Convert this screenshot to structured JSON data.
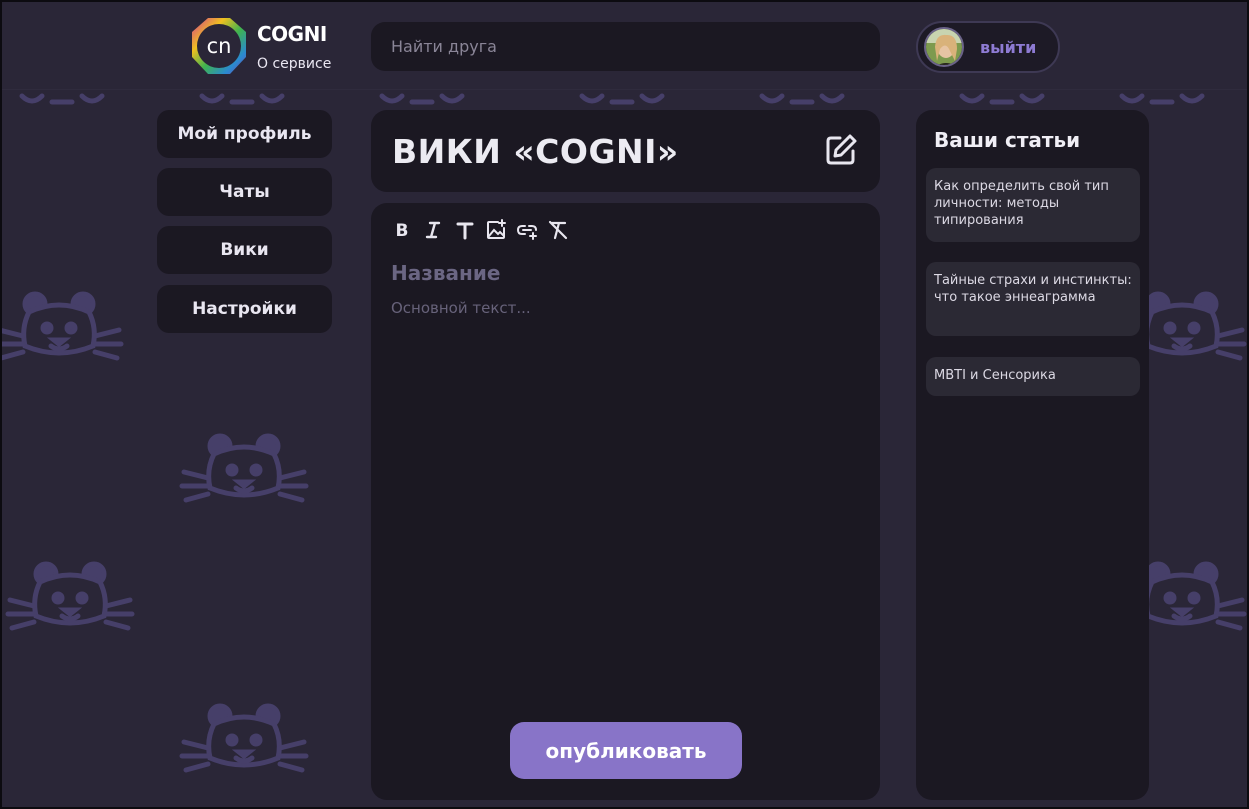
{
  "header": {
    "brand": "COGNI",
    "logo_text": "cn",
    "about_link": "О сервисе",
    "search_placeholder": "Найти друга",
    "logout_label": "выйти"
  },
  "nav": {
    "items": [
      {
        "label": "Мой профиль"
      },
      {
        "label": "Чаты"
      },
      {
        "label": "Вики"
      },
      {
        "label": "Настройки"
      }
    ]
  },
  "main": {
    "title": "ВИКИ «COGNI»",
    "editor": {
      "toolbar": [
        "bold-icon",
        "italic-icon",
        "text-icon",
        "image-add-icon",
        "link-add-icon",
        "clear-format-icon"
      ],
      "title_placeholder": "Название",
      "body_placeholder": "Основной текст...",
      "publish_label": "опубликовать"
    }
  },
  "sidebar": {
    "title": "Ваши статьи",
    "articles": [
      {
        "label": "Как определить свой тип личности: методы типирования"
      },
      {
        "label": "Тайные страхи и инстинкты: что такое эннеаграмма"
      },
      {
        "label": "MBTI и Сенсорика"
      }
    ]
  },
  "colors": {
    "background": "#2a2637",
    "card": "#1b1822",
    "accent": "#8874c8",
    "pattern": "#4a4270"
  }
}
